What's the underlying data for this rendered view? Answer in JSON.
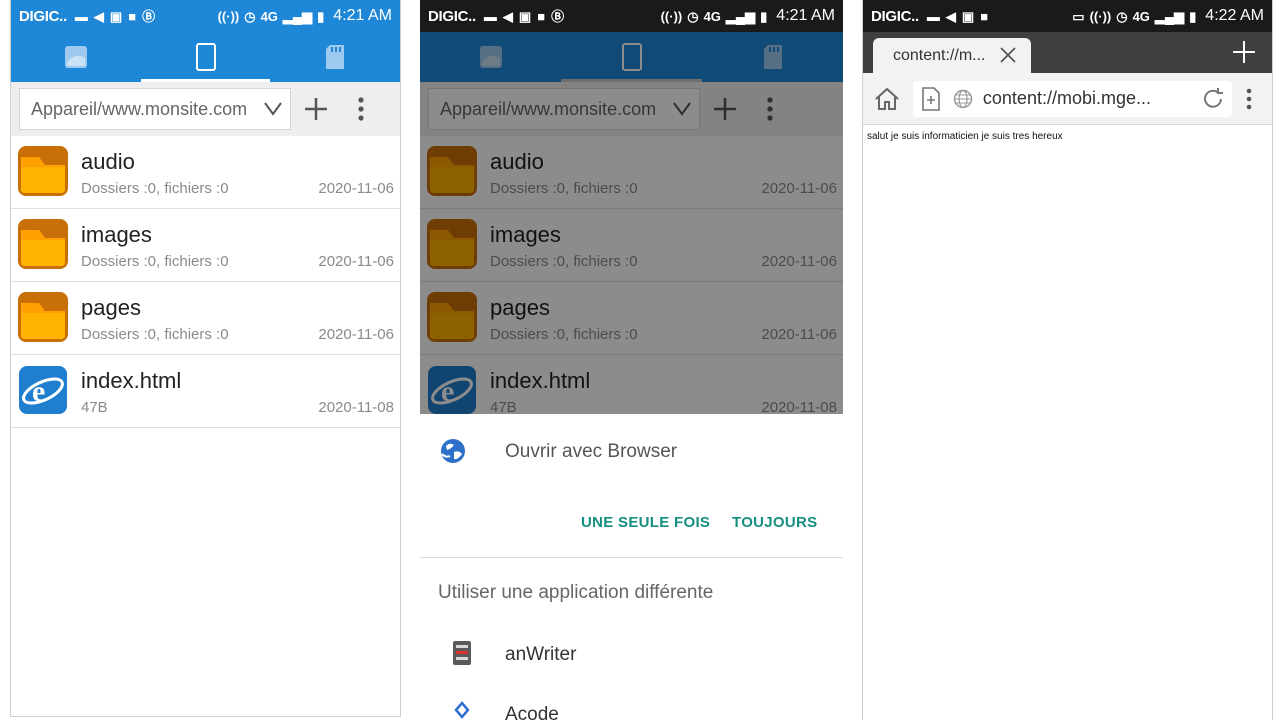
{
  "status": {
    "carrier": "DIGIC..",
    "time1": "4:21 AM",
    "time2": "4:21 AM",
    "time3": "4:22 AM",
    "network": "4G"
  },
  "explorer": {
    "tabs": [
      "sd-card",
      "device",
      "external-storage"
    ],
    "path": "Appareil/www.monsite.com",
    "files": [
      {
        "name": "audio",
        "sub": "Dossiers :0, fichiers :0",
        "date": "2020-11-06",
        "icon": "folder-icon"
      },
      {
        "name": "images",
        "sub": "Dossiers :0, fichiers :0",
        "date": "2020-11-06",
        "icon": "folder-icon"
      },
      {
        "name": "pages",
        "sub": "Dossiers :0, fichiers :0",
        "date": "2020-11-06",
        "icon": "folder-icon"
      },
      {
        "name": "index.html",
        "sub": "47B",
        "date": "2020-11-08",
        "icon": "ie-html-icon"
      }
    ]
  },
  "chooser": {
    "open_with": "Ouvrir avec Browser",
    "once": "UNE SEULE FOIS",
    "always": "TOUJOURS",
    "other": "Utiliser une application différente",
    "apps": [
      "anWriter",
      "Acode"
    ]
  },
  "browser": {
    "tab_title": "content://m...",
    "url": "content://mobi.mge...",
    "page_text": "salut je suis informaticien je suis tres hereux"
  },
  "colors": {
    "accent_blue": "#1e87d8",
    "folder_orange": "#f39c12",
    "teal_button": "#158f80"
  }
}
